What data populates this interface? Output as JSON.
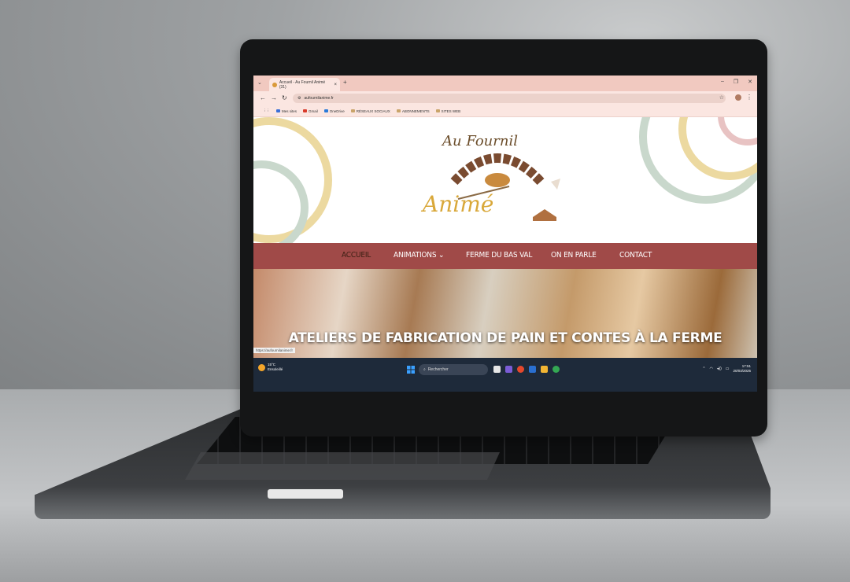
{
  "browser": {
    "tab_title": "Accueil - Au Fournil Animé (31)",
    "tab_close": "×",
    "new_tab": "+",
    "url": "aufournilanime.fr",
    "window_controls": [
      "–",
      "❐",
      "✕"
    ],
    "bookmarks": [
      {
        "label": "Mes sites",
        "icon": "site-icon"
      },
      {
        "label": "Gmail",
        "icon": "gmail-icon"
      },
      {
        "label": "OneDrive",
        "icon": "onedrive-icon"
      },
      {
        "label": "RÉSEAUX SOCIAUX",
        "icon": "folder-icon"
      },
      {
        "label": "ABONNEMENTS",
        "icon": "folder-icon"
      },
      {
        "label": "SITES WEB",
        "icon": "folder-icon"
      }
    ],
    "status_url": "https://aufournilanime.fr"
  },
  "site": {
    "logo_line1": "Au Fournil",
    "logo_line2": "Animé",
    "nav": [
      "ACCUEIL",
      "ANIMATIONS ⌄",
      "FERME DU BAS VAL",
      "ON EN PARLE",
      "CONTACT"
    ],
    "hero_title": "ATELIERS DE FABRICATION DE PAIN ET CONTES À LA FERME",
    "colors": {
      "nav_bg": "#a04a48",
      "arc_green": "#c9d8cc",
      "arc_yellow": "#ecd9a0",
      "arc_pink": "#e8c3c3"
    }
  },
  "taskbar": {
    "weather_temp": "15°C",
    "weather_desc": "Ensoleillé",
    "search_label": "Rechercher",
    "time": "17:51",
    "date": "20/03/2025"
  }
}
